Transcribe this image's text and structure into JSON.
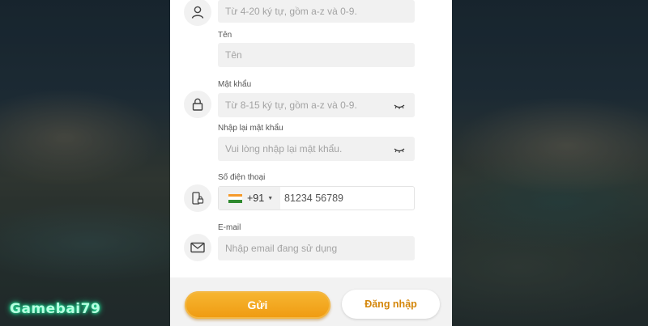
{
  "form": {
    "username": {
      "placeholder": "Từ 4-20 ký tự, gồm a-z và 0-9."
    },
    "name": {
      "label": "Tên",
      "placeholder": "Tên"
    },
    "password": {
      "label": "Mật khẩu",
      "placeholder": "Từ 8-15 ký tự, gồm a-z và 0-9."
    },
    "confirm_password": {
      "label": "Nhập lại mật khẩu",
      "placeholder": "Vui lòng nhập lại mật khẩu."
    },
    "phone": {
      "label": "Số điện thoại",
      "country_code": "+91",
      "value": "81234 56789",
      "caret": "▼"
    },
    "email": {
      "label": "E-mail",
      "placeholder": "Nhập email đang sử dụng"
    }
  },
  "buttons": {
    "send": "Gửi",
    "login": "Đăng nhập"
  },
  "watermark": "Gamebai79",
  "icons": {
    "user": "user-icon",
    "lock": "lock-icon",
    "phone": "phone-lock-icon",
    "mail": "mail-icon",
    "eye": "eye-closed-icon",
    "flag": "india-flag-icon"
  },
  "colors": {
    "accent": "#f0a020",
    "login_text": "#d4860a",
    "watermark_glow": "#22e39a"
  }
}
